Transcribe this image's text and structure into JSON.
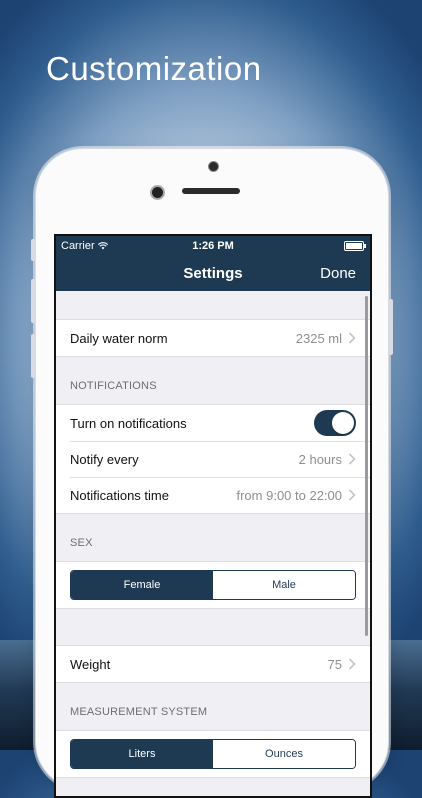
{
  "promo": {
    "headline": "Customization"
  },
  "status_bar": {
    "carrier": "Carrier",
    "time": "1:26 PM"
  },
  "navbar": {
    "title": "Settings",
    "done_label": "Done"
  },
  "water": {
    "label": "Daily water norm",
    "value": "2325 ml"
  },
  "notifications": {
    "header": "NOTIFICATIONS",
    "toggle_label": "Turn on notifications",
    "toggle_on": true,
    "notify_every_label": "Notify every",
    "notify_every_value": "2 hours",
    "time_label": "Notifications time",
    "time_value": "from 9:00 to 22:00"
  },
  "sex": {
    "header": "SEX",
    "options": [
      "Female",
      "Male"
    ],
    "selected": "Female"
  },
  "weight": {
    "label": "Weight",
    "value": "75"
  },
  "measurement": {
    "header": "MEASUREMENT SYSTEM",
    "options": [
      "Liters",
      "Ounces"
    ],
    "selected": "Liters"
  },
  "colors": {
    "accent": "#1e3a53",
    "background": "#efeff4"
  }
}
